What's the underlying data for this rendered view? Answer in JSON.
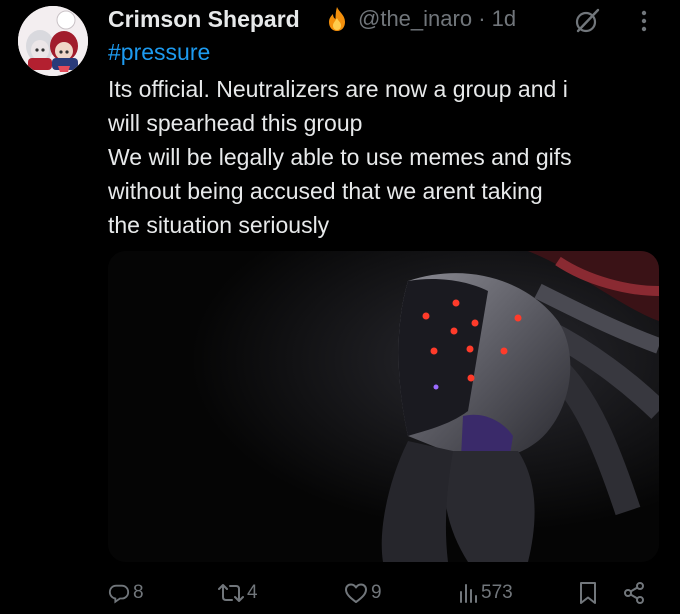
{
  "post": {
    "author_name": "Crimson Shepard",
    "handle": "@the_inaro",
    "separator": "·",
    "time": "1d",
    "hashtag": "#pressure",
    "body_lines": [
      "Its official. Neutralizers are now a group and i",
      "will spearhead this group",
      "We will be legally able to use memes and gifs",
      "without being accused that we arent taking",
      "the situation seriously"
    ]
  },
  "icons": {
    "author_badge": "flame-icon",
    "grok": "grok-icon",
    "more": "more-vertical-icon",
    "reply": "reply-icon",
    "repost": "repost-icon",
    "like": "heart-icon",
    "views": "views-icon",
    "bookmark": "bookmark-icon",
    "share": "share-icon"
  },
  "actions": {
    "replies": "8",
    "reposts": "4",
    "likes": "9",
    "views": "573"
  },
  "colors": {
    "background": "#000000",
    "text": "#e7e9ea",
    "muted": "#71767b",
    "link": "#1d9bf0"
  }
}
